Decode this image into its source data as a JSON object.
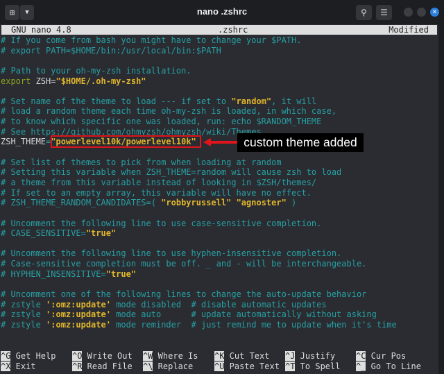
{
  "window": {
    "title": "nano .zshrc",
    "new_tab_icon": "new-tab-icon",
    "menu_icon": "hamburger-icon",
    "search_icon": "search-icon"
  },
  "nano_header": {
    "version": "GNU nano 4.8",
    "filename": ".zshrc",
    "status": "Modified"
  },
  "lines": [
    [
      {
        "t": "# If you come from bash you might have to change your $PATH.",
        "s": "c"
      }
    ],
    [
      {
        "t": "# export PATH=$HOME/bin:/usr/local/bin:$PATH",
        "s": "c"
      }
    ],
    [],
    [
      {
        "t": "# Path to your oh-my-zsh installation.",
        "s": "c"
      }
    ],
    [
      {
        "t": "export ",
        "s": "g"
      },
      {
        "t": "ZSH=",
        "s": "w"
      },
      {
        "t": "\"$HOME/.oh-my-zsh\"",
        "s": "y"
      }
    ],
    [],
    [
      {
        "t": "# Set name of the theme to load --- if set to ",
        "s": "c"
      },
      {
        "t": "\"random\"",
        "s": "y"
      },
      {
        "t": ", it will",
        "s": "c"
      }
    ],
    [
      {
        "t": "# load a random theme each time oh-my-zsh is loaded, in which case,",
        "s": "c"
      }
    ],
    [
      {
        "t": "# to know which specific one was loaded, run: echo $RANDOM_THEME",
        "s": "c"
      }
    ],
    [
      {
        "t": "# See https://github.com/ohmyzsh/ohmyzsh/wiki/Themes",
        "s": "c"
      }
    ],
    [
      {
        "t": "ZSH_THEME",
        "s": "w"
      },
      {
        "t": "=",
        "s": "c"
      },
      {
        "t": "\"powerlevel10k/powerlevel10k\"",
        "s": "y"
      }
    ],
    [],
    [
      {
        "t": "# Set list of themes to pick from when loading at random",
        "s": "c"
      }
    ],
    [
      {
        "t": "# Setting this variable when ZSH_THEME=random will cause zsh to load",
        "s": "c"
      }
    ],
    [
      {
        "t": "# a theme from this variable instead of looking in $ZSH/themes/",
        "s": "c"
      }
    ],
    [
      {
        "t": "# If set to an empty array, this variable will have no effect.",
        "s": "c"
      }
    ],
    [
      {
        "t": "# ZSH_THEME_RANDOM_CANDIDATES=( ",
        "s": "c"
      },
      {
        "t": "\"robbyrussell\"",
        "s": "y"
      },
      {
        "t": " ",
        "s": "c"
      },
      {
        "t": "\"agnoster\"",
        "s": "y"
      },
      {
        "t": " )",
        "s": "c"
      }
    ],
    [],
    [
      {
        "t": "# Uncomment the following line to use case-sensitive completion.",
        "s": "c"
      }
    ],
    [
      {
        "t": "# CASE_SENSITIVE=",
        "s": "c"
      },
      {
        "t": "\"true\"",
        "s": "y"
      }
    ],
    [],
    [
      {
        "t": "# Uncomment the following line to use hyphen-insensitive completion.",
        "s": "c"
      }
    ],
    [
      {
        "t": "# Case-sensitive completion must be off. _ and - will be interchangeable.",
        "s": "c"
      }
    ],
    [
      {
        "t": "# HYPHEN_INSENSITIVE=",
        "s": "c"
      },
      {
        "t": "\"true\"",
        "s": "y"
      }
    ],
    [],
    [
      {
        "t": "# Uncomment one of the following lines to change the auto-update behavior",
        "s": "c"
      }
    ],
    [
      {
        "t": "# zstyle ",
        "s": "c"
      },
      {
        "t": "':omz:update'",
        "s": "y"
      },
      {
        "t": " mode disabled  # disable automatic updates",
        "s": "c"
      }
    ],
    [
      {
        "t": "# zstyle ",
        "s": "c"
      },
      {
        "t": "':omz:update'",
        "s": "y"
      },
      {
        "t": " mode auto      # update automatically without asking",
        "s": "c"
      }
    ],
    [
      {
        "t": "# zstyle ",
        "s": "c"
      },
      {
        "t": "':omz:update'",
        "s": "y"
      },
      {
        "t": " mode reminder  # just remind me to update when it's time",
        "s": "c"
      }
    ]
  ],
  "shortcuts": [
    [
      {
        "key": "^G",
        "label": "Get Help"
      },
      {
        "key": "^O",
        "label": "Write Out"
      },
      {
        "key": "^W",
        "label": "Where Is"
      },
      {
        "key": "^K",
        "label": "Cut Text"
      },
      {
        "key": "^J",
        "label": "Justify"
      },
      {
        "key": "^C",
        "label": "Cur Pos"
      }
    ],
    [
      {
        "key": "^X",
        "label": "Exit"
      },
      {
        "key": "^R",
        "label": "Read File"
      },
      {
        "key": "^\\",
        "label": "Replace"
      },
      {
        "key": "^U",
        "label": "Paste Text"
      },
      {
        "key": "^T",
        "label": "To Spell"
      },
      {
        "key": "^_",
        "label": "Go To Line"
      }
    ]
  ],
  "annotation": {
    "label": "custom theme added",
    "color": "#e0141a"
  }
}
